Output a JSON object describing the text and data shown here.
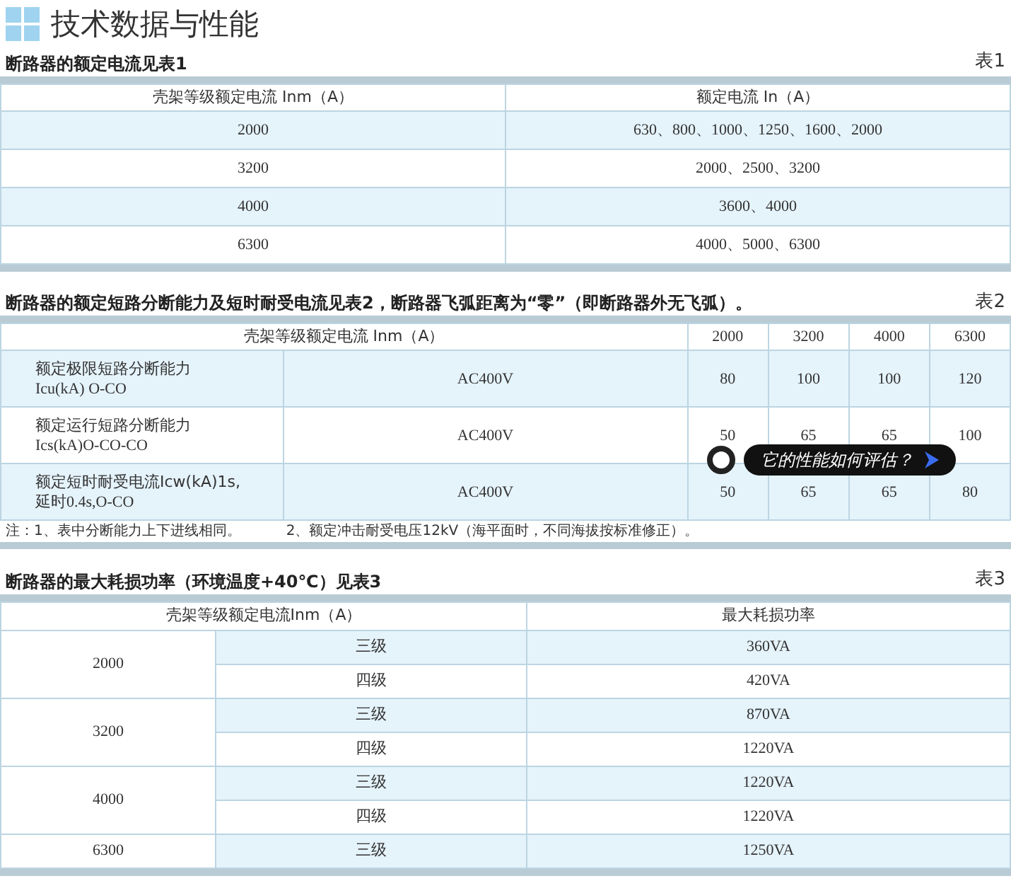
{
  "page_title": "技术数据与性能",
  "table1": {
    "caption": "断路器的额定电流见表1",
    "tag": "表1",
    "columns": [
      "壳架等级额定电流 Inm（A）",
      "额定电流 In（A）"
    ],
    "rows": [
      [
        "2000",
        "630、800、1000、1250、1600、2000"
      ],
      [
        "3200",
        "2000、2500、3200"
      ],
      [
        "4000",
        "3600、4000"
      ],
      [
        "6300",
        "4000、5000、6300"
      ]
    ]
  },
  "table2": {
    "caption": "断路器的额定短路分断能力及短时耐受电流见表2，断路器飞弧距离为“零”（即断路器外无飞弧）。",
    "tag": "表2",
    "columns": [
      "壳架等级额定电流 Inm（A）",
      "2000",
      "3200",
      "4000",
      "6300"
    ],
    "rows": [
      {
        "name": "额定极限短路分断能力",
        "code": "Icu(kA) O-CO",
        "voltage": "AC400V",
        "values": [
          "80",
          "100",
          "100",
          "120"
        ]
      },
      {
        "name": "额定运行短路分断能力",
        "code": "Ics(kA)O-CO-CO",
        "voltage": "AC400V",
        "values": [
          "50",
          "65",
          "65",
          "100"
        ]
      },
      {
        "name": "额定短时耐受电流Icw(kA)1s,",
        "code": "延时0.4s,O-CO",
        "voltage": "AC400V",
        "values": [
          "50",
          "65",
          "65",
          "80"
        ]
      }
    ],
    "notes": [
      "注：1、表中分断能力上下进线相同。",
      "2、额定冲击耐受电压12kV（海平面时，不同海拔按标准修正）。"
    ]
  },
  "tooltip": {
    "text": "它的性能如何评估？"
  },
  "table3": {
    "caption": "断路器的最大耗损功率（环境温度+40℃）见表3",
    "tag": "表3",
    "columns": [
      "壳架等级额定电流Inm（A）",
      "最大耗损功率"
    ],
    "groups": [
      {
        "frame": "2000",
        "rows": [
          {
            "poles": "三级",
            "power": "360VA"
          },
          {
            "poles": "四级",
            "power": "420VA"
          }
        ]
      },
      {
        "frame": "3200",
        "rows": [
          {
            "poles": "三级",
            "power": "870VA"
          },
          {
            "poles": "四级",
            "power": "1220VA"
          }
        ]
      },
      {
        "frame": "4000",
        "rows": [
          {
            "poles": "三级",
            "power": "1220VA"
          },
          {
            "poles": "四级",
            "power": "1220VA"
          }
        ]
      },
      {
        "frame": "6300",
        "rows": [
          {
            "poles": "三级",
            "power": "1250VA"
          }
        ]
      }
    ]
  }
}
